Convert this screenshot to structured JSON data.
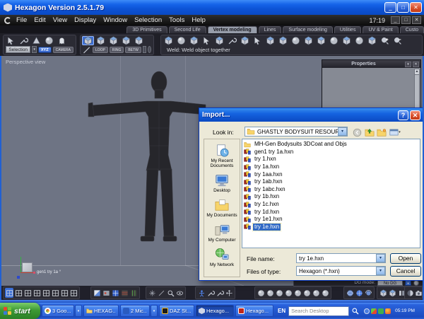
{
  "window": {
    "title": "Hexagon Version 2.5.1.79",
    "menu_clock": "17:19"
  },
  "menu": {
    "items": [
      "File",
      "Edit",
      "View",
      "Display",
      "Window",
      "Selection",
      "Tools",
      "Help"
    ]
  },
  "tabs": [
    "3D Primitives",
    "Second Life",
    "Vertex modeling",
    "Lines",
    "Surface modeling",
    "Utilities",
    "UV & Paint",
    "Custo"
  ],
  "toolbar": {
    "selection": "Selection",
    "xyz": "XYZ",
    "camera": "CAMERA",
    "loop": "LOOP",
    "ring": "RING",
    "betw": "BETW",
    "status": "Weld: Weld object together"
  },
  "viewport": {
    "view_label": "Perspective view",
    "object_label": "gen1 try 1a °"
  },
  "properties": {
    "title": "Properties"
  },
  "dg": {
    "label": "DG mode:",
    "value": "No DG"
  },
  "dialog": {
    "title": "Import...",
    "look_in_label": "Look in:",
    "look_in_value": "GHASTLY BODYSUIT RESOURCE KIT",
    "places": [
      "My Recent Documents",
      "Desktop",
      "My Documents",
      "My Computer",
      "My Network"
    ],
    "files": [
      {
        "name": "MH-Gen Bodysuits 3DCoat and Objs",
        "type": "folder"
      },
      {
        "name": "gen1 try 1a.hxn",
        "type": "hxn"
      },
      {
        "name": "try 1.hxn",
        "type": "hxn"
      },
      {
        "name": "try 1a.hxn",
        "type": "hxn"
      },
      {
        "name": "try 1aa.hxn",
        "type": "hxn"
      },
      {
        "name": "try 1ab.hxn",
        "type": "hxn"
      },
      {
        "name": "try 1abc.hxn",
        "type": "hxn"
      },
      {
        "name": "try 1b.hxn",
        "type": "hxn"
      },
      {
        "name": "try 1c.hxn",
        "type": "hxn"
      },
      {
        "name": "try 1d.hxn",
        "type": "hxn"
      },
      {
        "name": "try 1e1.hxn",
        "type": "hxn"
      },
      {
        "name": "try 1e.hxn",
        "type": "hxn",
        "selected": true
      }
    ],
    "file_name_label": "File name:",
    "file_name_value": "try 1e.hxn",
    "files_of_type_label": "Files of type:",
    "files_of_type_value": "Hexagon (*.hxn)",
    "open": "Open",
    "cancel": "Cancel"
  },
  "taskbar": {
    "start": "start",
    "tasks": [
      "3 Goo...",
      "HEXAG...",
      "2 Mic...",
      "DAZ St...",
      "Hexago...",
      "Hexago..."
    ],
    "language": "EN",
    "search_placeholder": "Search Desktop",
    "clock": "05:19 PM"
  },
  "icons": {
    "help_glyph": "?",
    "close_glyph": "✕",
    "minimize_glyph": "_",
    "maximize_glyph": "□",
    "caret_down": "▾"
  },
  "colors": {
    "accent_blue": "#3b6fd8",
    "selection_blue": "#316ac5",
    "xp_titlebar_blue": "#1563e8",
    "start_green": "#3d9a35",
    "viewport_gray": "#6e7484"
  }
}
